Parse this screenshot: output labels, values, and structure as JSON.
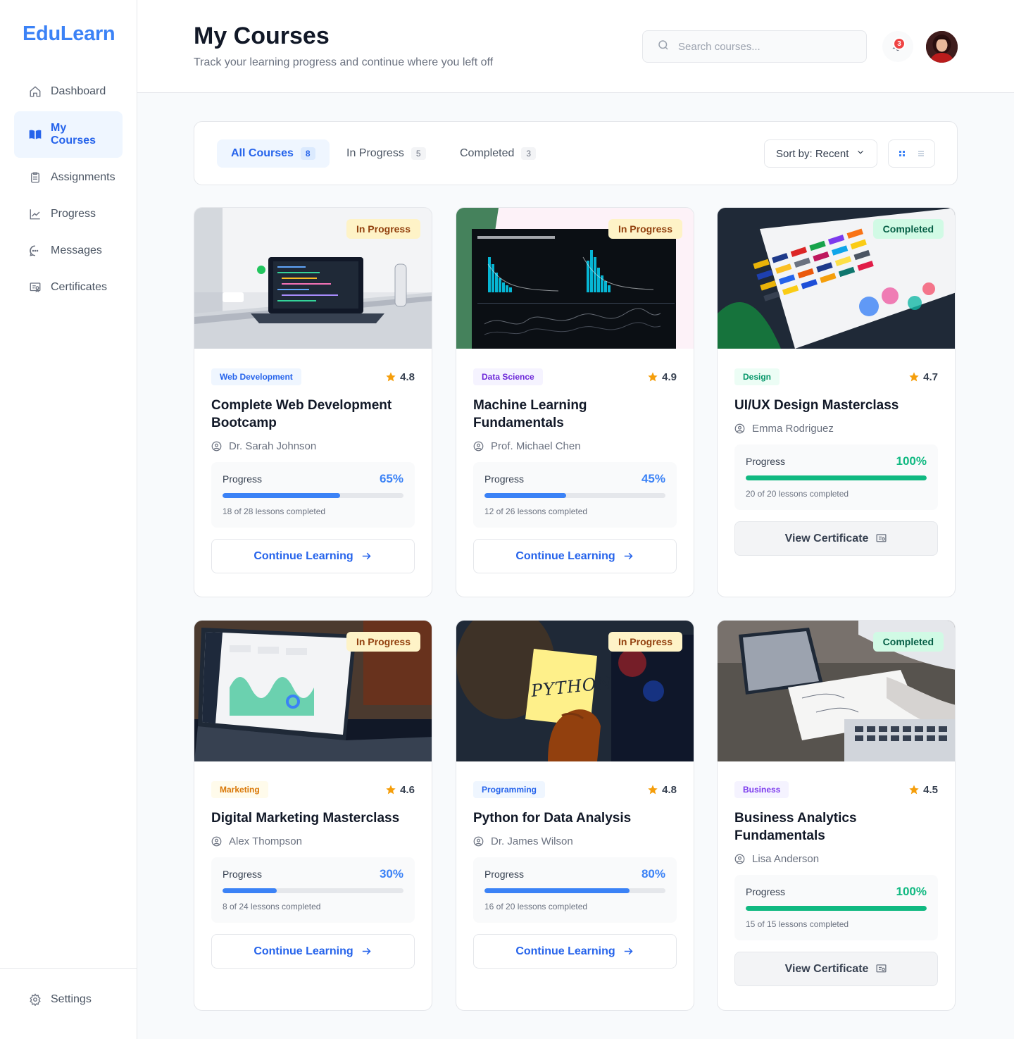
{
  "app": {
    "logo": "EduLearn"
  },
  "sidebar": {
    "items": [
      {
        "label": "Dashboard",
        "icon": "home-icon"
      },
      {
        "label": "My Courses",
        "icon": "book-open-icon"
      },
      {
        "label": "Assignments",
        "icon": "clipboard-icon"
      },
      {
        "label": "Progress",
        "icon": "chart-line-icon"
      },
      {
        "label": "Messages",
        "icon": "chat-icon"
      },
      {
        "label": "Certificates",
        "icon": "certificate-icon"
      }
    ],
    "active_index": 1,
    "settings_label": "Settings"
  },
  "header": {
    "title": "My Courses",
    "subtitle": "Track your learning progress and continue where you left off",
    "search_placeholder": "Search courses...",
    "notification_count": "3"
  },
  "filters": {
    "tabs": [
      {
        "label": "All Courses",
        "count": "8"
      },
      {
        "label": "In Progress",
        "count": "5"
      },
      {
        "label": "Completed",
        "count": "3"
      }
    ],
    "active_tab": 0,
    "sort_label": "Sort by: Recent"
  },
  "colors": {
    "accent": "#2563eb",
    "accent_bar": "#3b82f6",
    "complete": "#10b981"
  },
  "courses": [
    {
      "status": "In Progress",
      "category": "Web Development",
      "rating": "4.8",
      "title": "Complete Web Development Bootcamp",
      "instructor": "Dr. Sarah Johnson",
      "progress_label": "Progress",
      "progress_pct": "65%",
      "progress": 0.65,
      "lessons": "18 of 28 lessons completed",
      "cta": "Continue Learning"
    },
    {
      "status": "In Progress",
      "category": "Data Science",
      "rating": "4.9",
      "title": "Machine Learning Fundamentals",
      "instructor": "Prof. Michael Chen",
      "progress_label": "Progress",
      "progress_pct": "45%",
      "progress": 0.45,
      "lessons": "12 of 26 lessons completed",
      "cta": "Continue Learning"
    },
    {
      "status": "Completed",
      "category": "Design",
      "rating": "4.7",
      "title": "UI/UX Design Masterclass",
      "instructor": "Emma Rodriguez",
      "progress_label": "Progress",
      "progress_pct": "100%",
      "progress": 1.0,
      "lessons": "20 of 20 lessons completed",
      "cta": "View Certificate"
    },
    {
      "status": "In Progress",
      "category": "Marketing",
      "rating": "4.6",
      "title": "Digital Marketing Masterclass",
      "instructor": "Alex Thompson",
      "progress_label": "Progress",
      "progress_pct": "30%",
      "progress": 0.3,
      "lessons": "8 of 24 lessons completed",
      "cta": "Continue Learning"
    },
    {
      "status": "In Progress",
      "category": "Programming",
      "rating": "4.8",
      "title": "Python for Data Analysis",
      "instructor": "Dr. James Wilson",
      "progress_label": "Progress",
      "progress_pct": "80%",
      "progress": 0.8,
      "lessons": "16 of 20 lessons completed",
      "cta": "Continue Learning"
    },
    {
      "status": "Completed",
      "category": "Business",
      "rating": "4.5",
      "title": "Business Analytics Fundamentals",
      "instructor": "Lisa Anderson",
      "progress_label": "Progress",
      "progress_pct": "100%",
      "progress": 1.0,
      "lessons": "15 of 15 lessons completed",
      "cta": "View Certificate"
    }
  ],
  "thumb_texts": {
    "python_note": "PYTHON"
  }
}
